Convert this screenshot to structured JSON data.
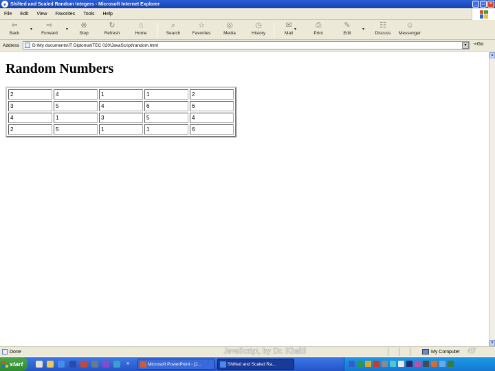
{
  "window": {
    "title": "Shifted and Scaled Random Integers - Microsoft Internet Explorer",
    "controls": {
      "minimize": "_",
      "maximize": "□",
      "close": "×"
    }
  },
  "menu": [
    "File",
    "Edit",
    "View",
    "Favorites",
    "Tools",
    "Help"
  ],
  "toolbar": {
    "back": "Back",
    "forward": "Forward",
    "stop": "Stop",
    "refresh": "Refresh",
    "home": "Home",
    "search": "Search",
    "favorites": "Favorites",
    "media": "Media",
    "history": "History",
    "mail": "Mail",
    "print": "Print",
    "edit": "Edit",
    "discuss": "Discuss",
    "messenger": "Messenger"
  },
  "address": {
    "label": "Address",
    "url": "D:\\My documents\\IT Diploma\\ITEC 020\\JavaScript\\random.html",
    "go": "Go"
  },
  "page": {
    "heading": "Random Numbers",
    "table": [
      [
        "2",
        "4",
        "1",
        "1",
        "2"
      ],
      [
        "3",
        "5",
        "4",
        "6",
        "6"
      ],
      [
        "4",
        "1",
        "3",
        "5",
        "4"
      ],
      [
        "2",
        "5",
        "1",
        "1",
        "6"
      ]
    ]
  },
  "status": {
    "done": "Done",
    "zone": "My Computer"
  },
  "slide": {
    "footer": "JavaScript, by Dr. Khalil",
    "number": "47"
  },
  "taskbar": {
    "start": "start",
    "tasks": [
      "Microsoft PowerPoint - [J...",
      "Shifted and Scaled Ra..."
    ],
    "chevron": "»"
  },
  "colors": {
    "titlebar": "#1a3fb0",
    "chrome": "#ece9d8",
    "taskbar": "#2454c8",
    "start": "#2e8a2e"
  }
}
